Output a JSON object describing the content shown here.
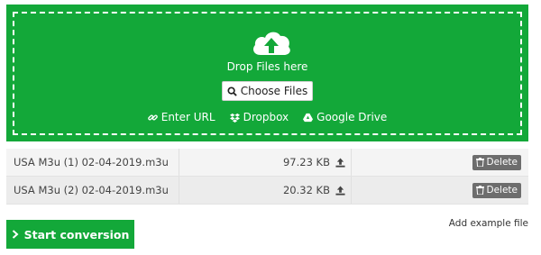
{
  "dropzone": {
    "drop_text": "Drop Files here",
    "choose_label": "Choose Files",
    "sources": {
      "url_label": "Enter URL",
      "dropbox_label": "Dropbox",
      "gdrive_label": "Google Drive"
    },
    "background_color": "#13a839",
    "icon": "cloud-upload-icon"
  },
  "files": [
    {
      "name": "USA M3u (1) 02-04-2019.m3u",
      "size": "97.23 KB",
      "delete_label": "Delete"
    },
    {
      "name": "USA M3u (2) 02-04-2019.m3u",
      "size": "20.32 KB",
      "delete_label": "Delete"
    }
  ],
  "actions": {
    "start_label": "Start conversion",
    "add_example_label": "Add example file"
  }
}
